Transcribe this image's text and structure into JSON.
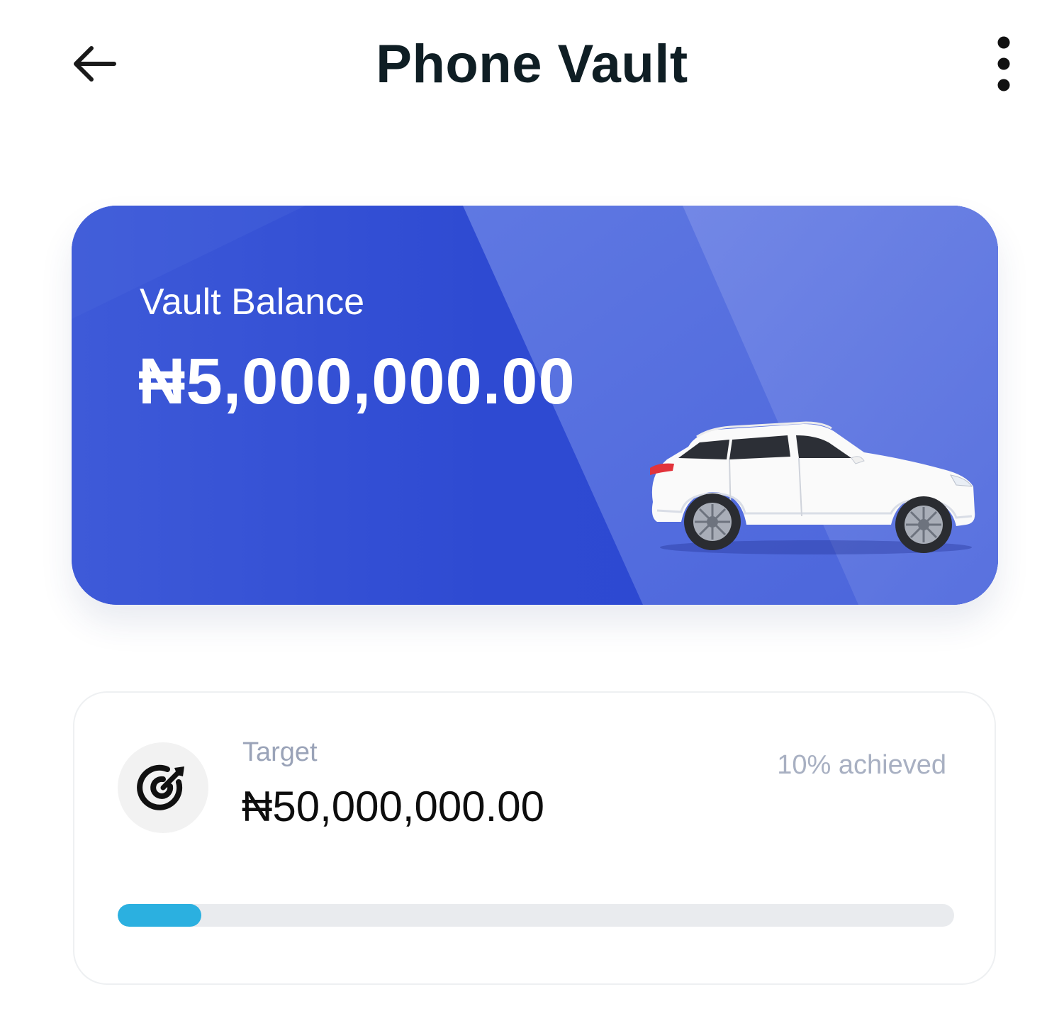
{
  "header": {
    "title": "Phone Vault",
    "back_icon": "arrow-left-icon",
    "menu_icon": "more-vertical-icon"
  },
  "balance_card": {
    "label": "Vault Balance",
    "amount": "₦5,000,000.00",
    "image": "car-image",
    "background_color": "#2f4bd3"
  },
  "target_card": {
    "icon": "target-icon",
    "label": "Target",
    "amount": "₦50,000,000.00",
    "achieved_text": "10% achieved",
    "progress_fraction": 0.1,
    "progress_color": "#2bb0e0"
  }
}
